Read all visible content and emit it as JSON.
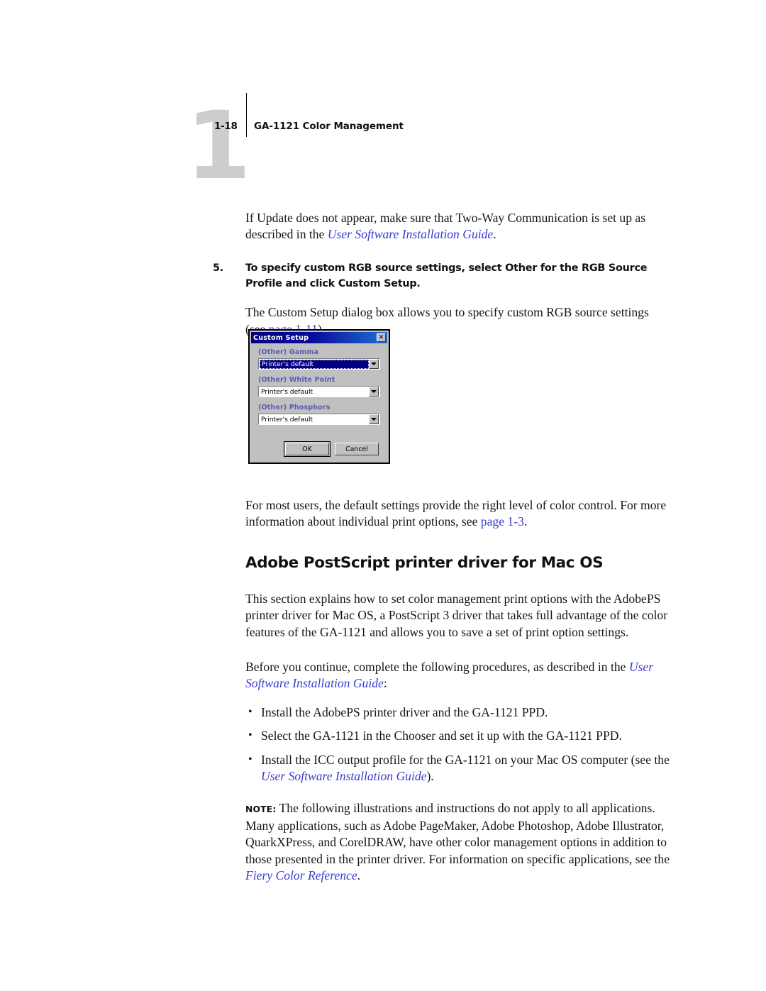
{
  "header": {
    "chapter_number": "1",
    "folio": "1-18",
    "running_head": "GA-1121 Color Management"
  },
  "content": {
    "intro_p1_before": "If Update does not appear, make sure that Two-Way Communication is set up as described in the ",
    "intro_p1_link": "User Software Installation Guide",
    "intro_p1_after": ".",
    "step_number": "5.",
    "step_text": "To specify custom RGB source settings, select Other for the RGB Source Profile and click Custom Setup.",
    "step_p_before": "The Custom Setup dialog box allows you to specify custom RGB source settings (see ",
    "step_p_link": "page 1-11",
    "step_p_after": ").",
    "after_dialog_before": "For most users, the default settings provide the right level of color control. For more information about individual print options, see ",
    "after_dialog_link": "page 1-3",
    "after_dialog_after": ".",
    "section_heading": "Adobe PostScript printer driver for Mac OS",
    "section_p1": "This section explains how to set color management print options with the AdobePS printer driver for Mac OS, a PostScript 3 driver that takes full advantage of the color features of the GA-1121 and allows you to save a set of print option settings.",
    "section_p2_before": "Before you continue, complete the following procedures, as described in the ",
    "section_p2_link": "User Software Installation Guide",
    "section_p2_after": ":",
    "bullets": [
      {
        "text": "Install the AdobePS printer driver and the GA-1121 PPD."
      },
      {
        "text": "Select the GA-1121 in the Chooser and set it up with the GA-1121 PPD."
      }
    ],
    "bullet3_before": "Install the ICC output profile for the GA-1121 on your Mac OS computer (see the ",
    "bullet3_link": "User Software Installation Guide",
    "bullet3_after": ").",
    "note_label": "NOTE:",
    "note_text": " The following illustrations and instructions do not apply to all applications. Many applications, such as Adobe PageMaker, Adobe Photoshop, Adobe Illustrator, QuarkXPress, and CorelDRAW, have other color management options in addition to those presented in the printer driver. For information on specific applications, see the ",
    "note_link": "Fiery Color Reference",
    "note_after": "."
  },
  "dialog": {
    "title": "Custom Setup",
    "close_icon": "✕",
    "fields": [
      {
        "label": "(Other) Gamma",
        "value": "Printer's default",
        "focused": true
      },
      {
        "label": "(Other) White Point",
        "value": "Printer's default",
        "focused": false
      },
      {
        "label": "(Other) Phosphors",
        "value": "Printer's default",
        "focused": false
      }
    ],
    "ok_label": "OK",
    "cancel_label": "Cancel"
  },
  "colors": {
    "link": "#3b3bcf",
    "dialog_label": "#5a5ab4",
    "titlebar_start": "#00007e",
    "titlebar_end": "#1f6fd0",
    "dialog_face": "#c0c0c0",
    "ghost_number": "#cdcdcd"
  }
}
